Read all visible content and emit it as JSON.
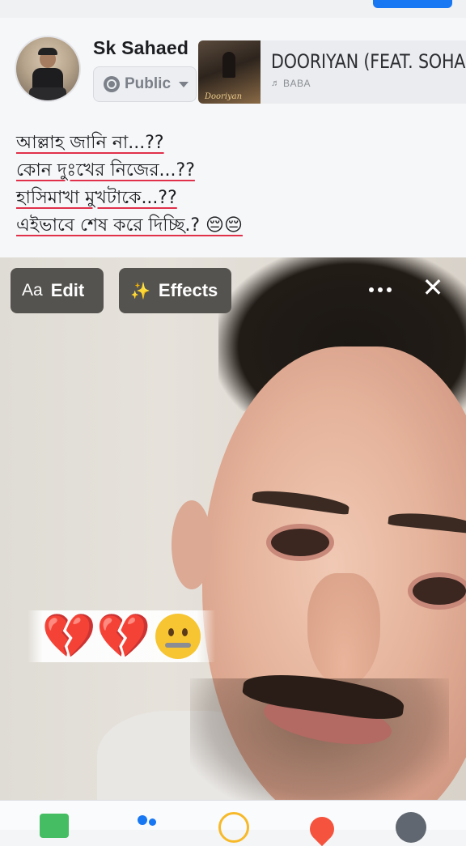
{
  "composer": {
    "user_name": "Sk Sahaed",
    "privacy": {
      "label": "Public",
      "icon": "globe-icon"
    },
    "music": {
      "song_title": "DOORIYAN (FEAT. SOHAM",
      "artist": "BABA",
      "album_script": "Dooriyan"
    },
    "caption_lines": [
      "আল্লাহ জানি না...??",
      "কোন দুঃখের নিজের...??",
      "হাসিমাখা মুখটাকে...??",
      "এইভাবে শেষ করে দিচ্ছি.? 😔😔"
    ]
  },
  "photo_tools": {
    "edit_label": "Edit",
    "edit_icon_text": "Aa",
    "effects_label": "Effects",
    "close_glyph": "✕"
  },
  "sticker": {
    "text": "💔💔"
  },
  "bottom_bar": {
    "icons": [
      "photo-icon",
      "tag-people-icon",
      "feeling-icon",
      "check-in-icon",
      "more-icon"
    ]
  },
  "colors": {
    "brand_blue": "#1877f2",
    "underline_red": "#e0304a",
    "tool_button_bg": "#55534f"
  }
}
